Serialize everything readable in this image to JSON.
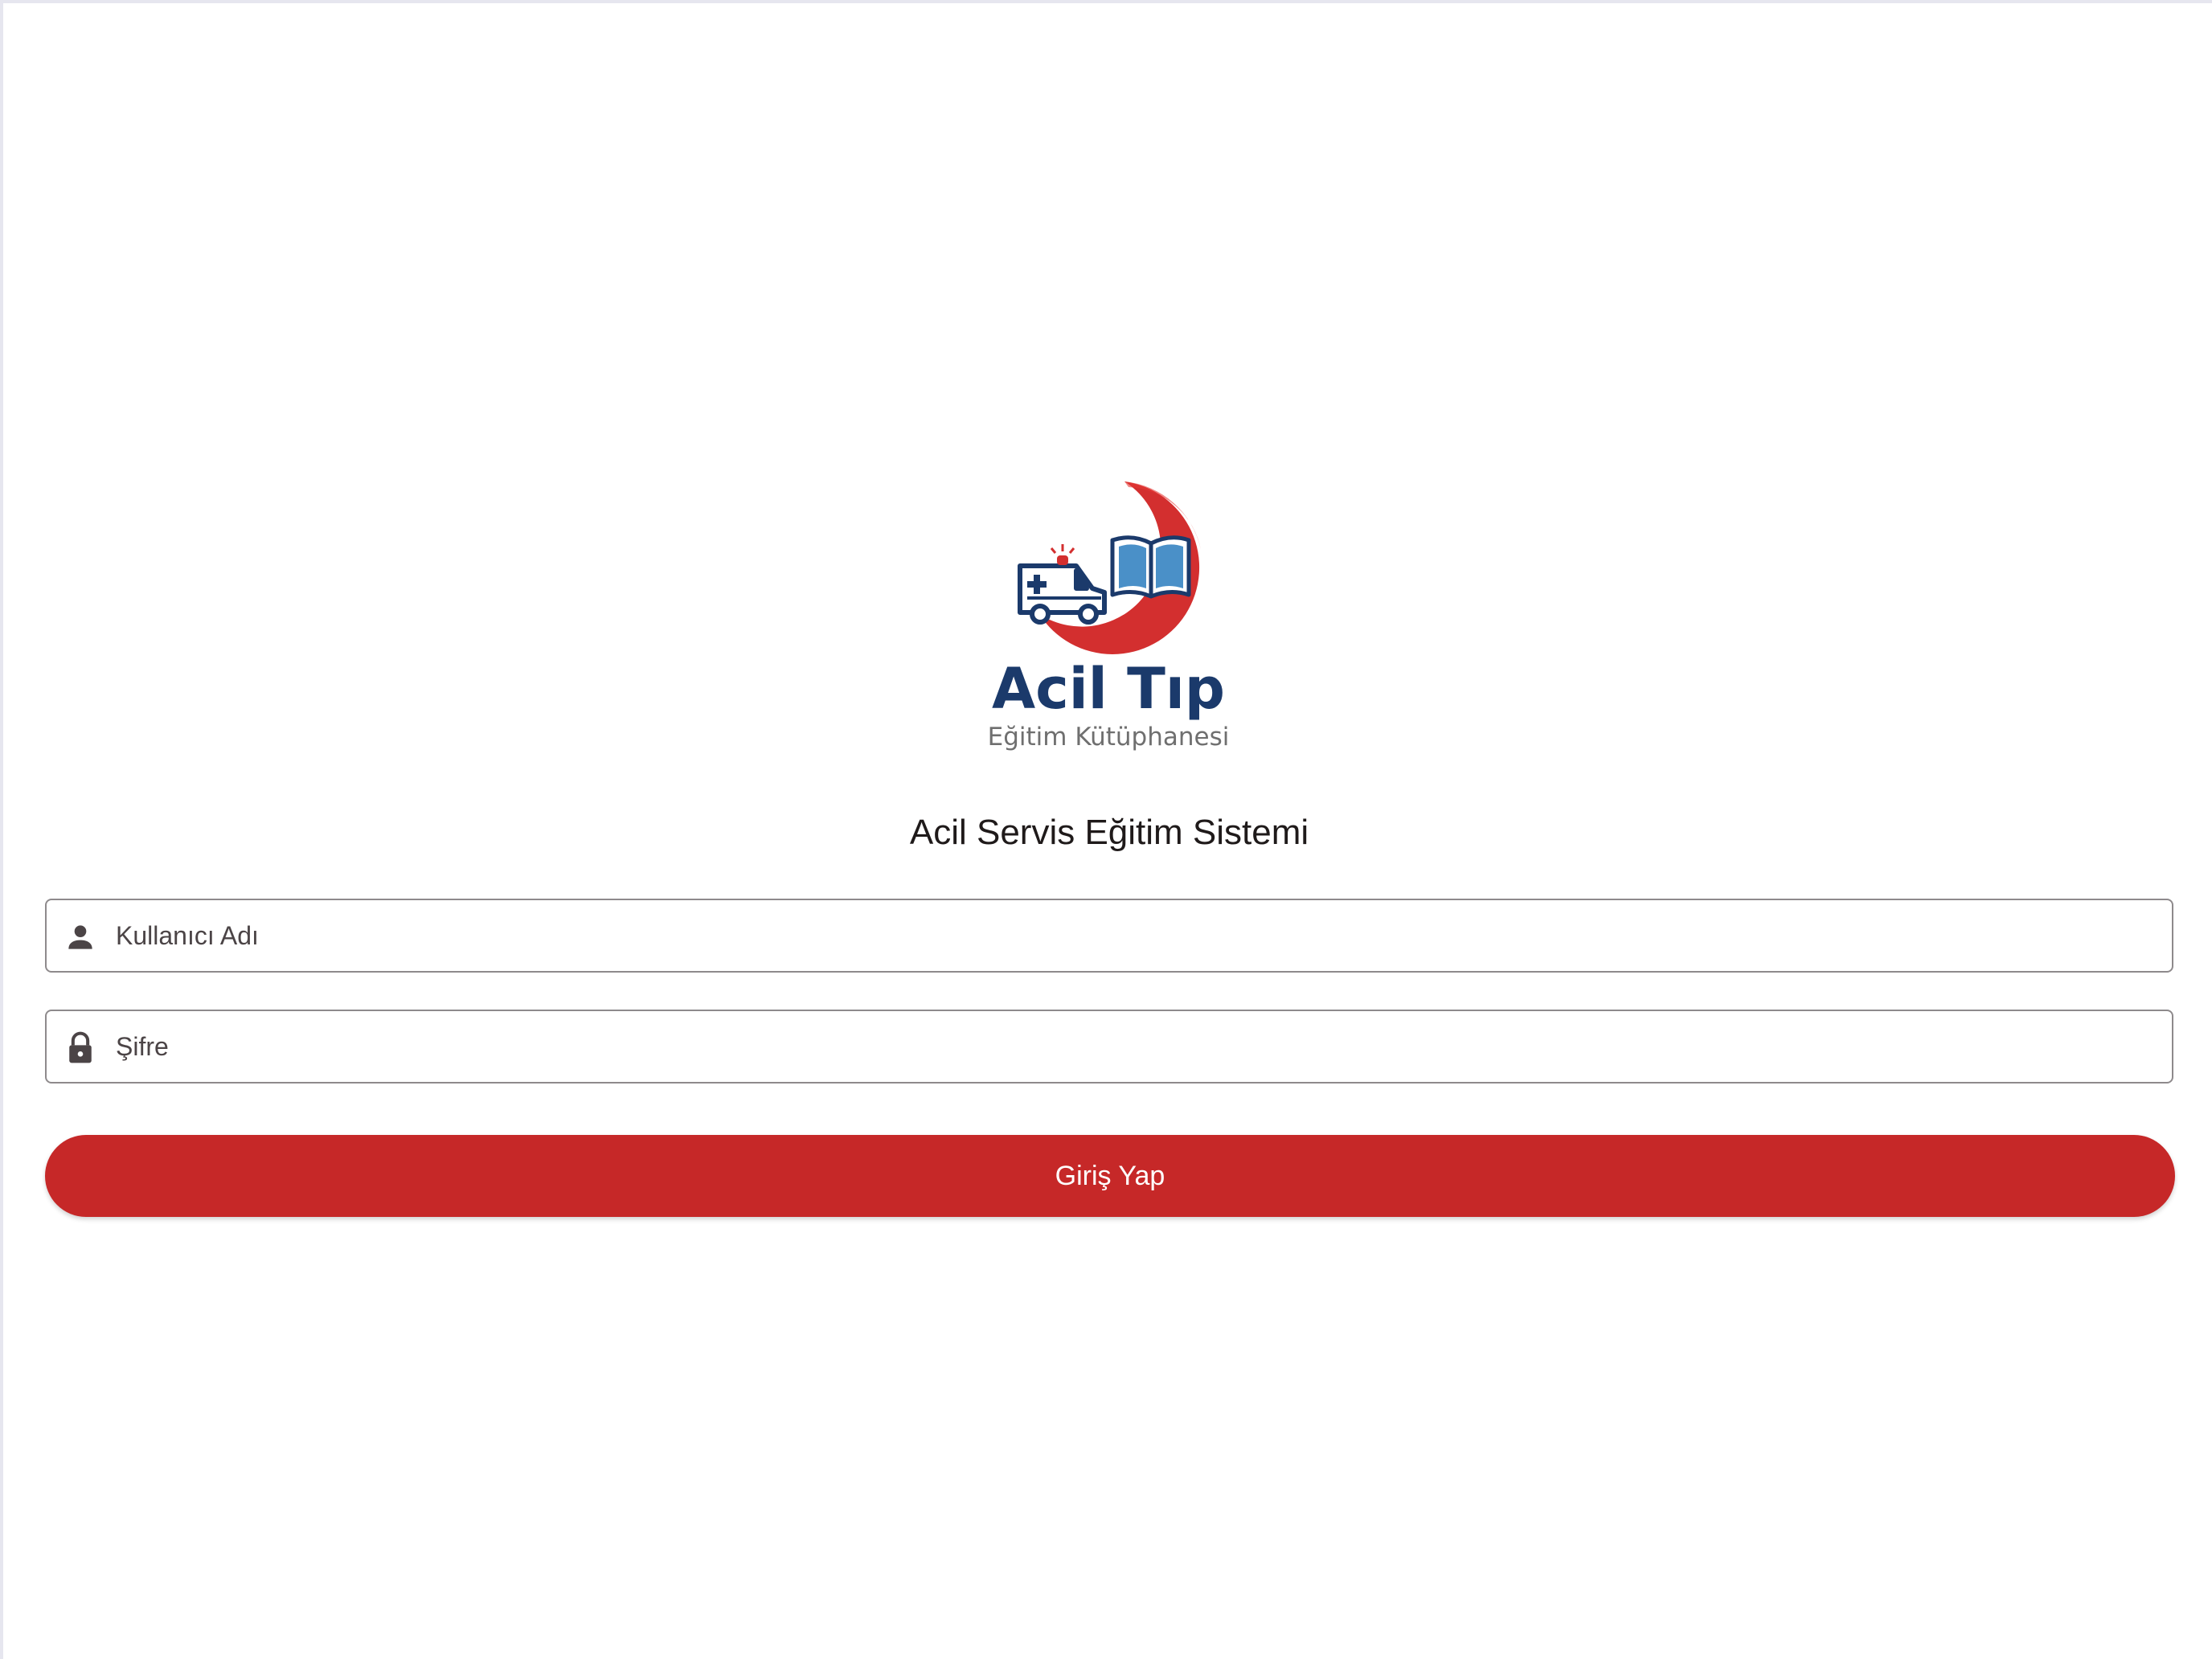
{
  "logo": {
    "title": "Acil Tıp",
    "subtitle": "Eğitim Kütüphanesi"
  },
  "page": {
    "title": "Acil Servis Eğitim Sistemi"
  },
  "form": {
    "username_placeholder": "Kullanıcı Adı",
    "username_value": "",
    "password_placeholder": "Şifre",
    "password_value": "",
    "submit_label": "Giriş Yap"
  },
  "icons": {
    "username": "person-icon",
    "password": "lock-icon"
  },
  "colors": {
    "accent": "#c62828",
    "brand_navy": "#1b3a6b",
    "logo_red": "#d32f2f",
    "book_blue": "#4a90c8"
  }
}
